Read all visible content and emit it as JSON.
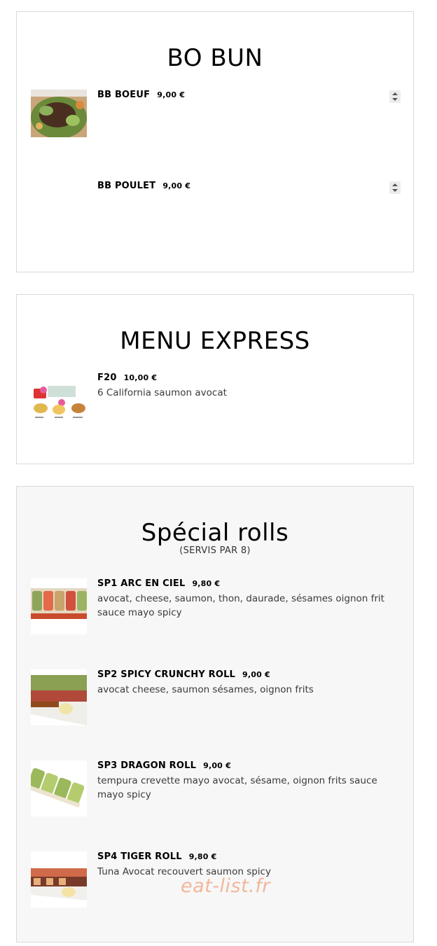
{
  "sections": {
    "bo_bun": {
      "title": "BO BUN",
      "items": [
        {
          "name": "BB BOEUF",
          "price": "9,00 €",
          "desc": ""
        },
        {
          "name": "BB POULET",
          "price": "9,00 €",
          "desc": ""
        }
      ]
    },
    "menu_express": {
      "title": "MENU EXPRESS",
      "items": [
        {
          "name": "F20",
          "price": "10,00 €",
          "desc": "6 California saumon avocat"
        }
      ]
    },
    "special_rolls": {
      "title": "Spécial rolls",
      "subtitle": "(SERVIS PAR 8)",
      "items": [
        {
          "name": "SP1 ARC EN CIEL",
          "price": "9,80 €",
          "desc": "avocat, cheese, saumon, thon, daurade, sésames oignon frit sauce mayo spicy"
        },
        {
          "name": "SP2 SPICY CRUNCHY ROLL",
          "price": "9,00 €",
          "desc": "avocat cheese, saumon sésames, oignon frits"
        },
        {
          "name": "SP3 DRAGON ROLL",
          "price": "9,00 €",
          "desc": "tempura crevette mayo avocat, sésame, oignon frits sauce mayo spicy"
        },
        {
          "name": "SP4 TIGER ROLL",
          "price": "9,80 €",
          "desc": "Tuna Avocat recouvert saumon spicy"
        }
      ]
    }
  },
  "watermark": "eat-list.fr",
  "icons": {
    "stepper": "quantity-stepper-icon"
  }
}
